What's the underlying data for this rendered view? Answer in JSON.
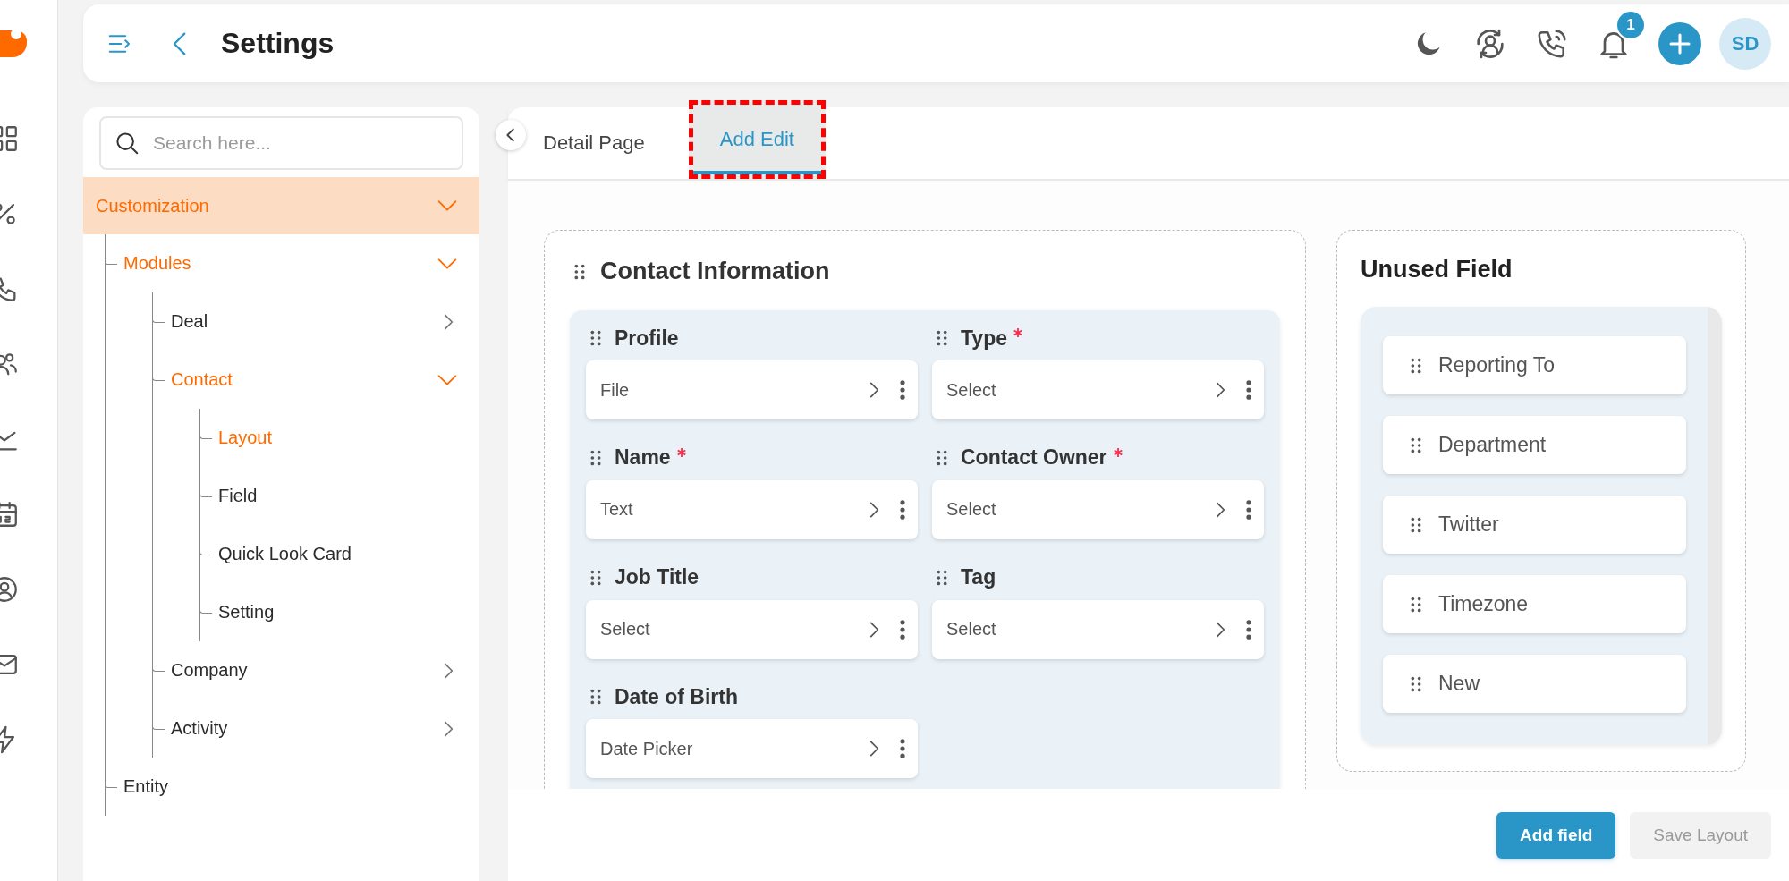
{
  "header": {
    "title": "Settings",
    "notification_count": "1",
    "avatar": "SD"
  },
  "search": {
    "placeholder": "Search here..."
  },
  "tree": [
    {
      "label": "Customization",
      "active": true,
      "expanded": true,
      "children": [
        {
          "label": "Modules",
          "active": true,
          "expanded": true,
          "children": [
            {
              "label": "Deal",
              "active": false,
              "expanded": false
            },
            {
              "label": "Contact",
              "active": true,
              "expanded": true,
              "children": [
                {
                  "label": "Layout",
                  "active": true
                },
                {
                  "label": "Field",
                  "active": false
                },
                {
                  "label": "Quick Look Card",
                  "active": false
                },
                {
                  "label": "Setting",
                  "active": false
                }
              ]
            },
            {
              "label": "Company",
              "active": false,
              "expanded": false
            },
            {
              "label": "Activity",
              "active": false,
              "expanded": false
            }
          ]
        },
        {
          "label": "Entity",
          "active": false
        }
      ]
    }
  ],
  "tabs": [
    {
      "label": "Detail Page",
      "selected": false,
      "highlighted": false
    },
    {
      "label": "Add Edit",
      "selected": true,
      "highlighted": true
    }
  ],
  "section": {
    "title": "Contact Information",
    "fields": [
      {
        "label": "Profile",
        "required": false,
        "value": "File"
      },
      {
        "label": "Type",
        "required": true,
        "value": "Select"
      },
      {
        "label": "Name",
        "required": true,
        "value": "Text"
      },
      {
        "label": "Contact Owner",
        "required": true,
        "value": "Select"
      },
      {
        "label": "Job Title",
        "required": false,
        "value": "Select"
      },
      {
        "label": "Tag",
        "required": false,
        "value": "Select"
      },
      {
        "label": "Date of Birth",
        "required": false,
        "value": "Date Picker"
      }
    ]
  },
  "unused": {
    "title": "Unused Field",
    "items": [
      "Reporting To",
      "Department",
      "Twitter",
      "Timezone",
      "New"
    ]
  },
  "buttons": [
    {
      "label": "Add field",
      "disabled": false
    },
    {
      "label": "Save Layout",
      "disabled": true
    }
  ]
}
